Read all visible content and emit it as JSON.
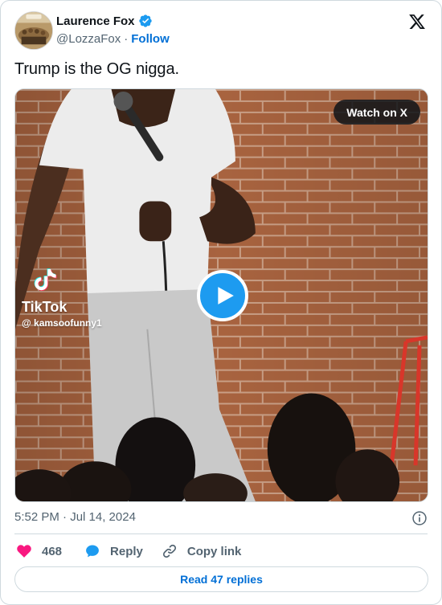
{
  "author": {
    "name": "Laurence Fox",
    "handle": "@LozzaFox",
    "separator": "·",
    "follow_label": "Follow",
    "verified": true
  },
  "brand": {
    "logo": "x-logo-icon"
  },
  "tweet": {
    "text": "Trump is the OG nigga."
  },
  "media": {
    "watch_label": "Watch on X",
    "watermark_name": "TikTok",
    "watermark_user": "@ kamsoofunny1",
    "play_icon": "play-icon"
  },
  "meta": {
    "timestamp": "5:52 PM · Jul 14, 2024",
    "info_icon": "info-icon"
  },
  "actions": {
    "like_count": "468",
    "reply_label": "Reply",
    "copy_label": "Copy link"
  },
  "footer": {
    "read_replies_label": "Read 47 replies"
  },
  "colors": {
    "accent": "#1d9bf0",
    "link": "#006fd6",
    "like": "#f91880",
    "muted": "#536471",
    "border": "#cfd9de"
  }
}
